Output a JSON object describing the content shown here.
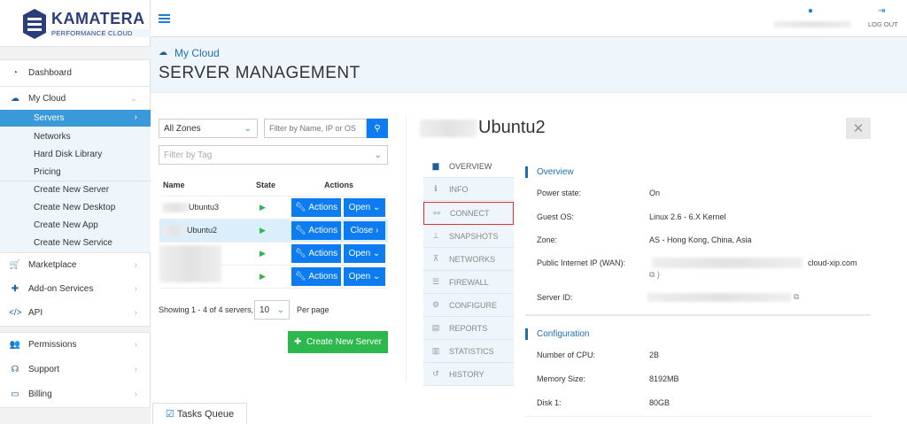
{
  "brand": {
    "name": "KAMATERA",
    "tagline": "PERFORMANCE CLOUD"
  },
  "topbar": {
    "logout": "LOG OUT"
  },
  "sidebar": {
    "items": [
      {
        "label": "Dashboard",
        "icon": "dashboard-icon"
      },
      {
        "label": "My Cloud",
        "icon": "cloud-icon"
      },
      {
        "label": "Marketplace",
        "icon": "cart-icon"
      },
      {
        "label": "Add-on Services",
        "icon": "puzzle-icon"
      },
      {
        "label": "API",
        "icon": "code-icon"
      },
      {
        "label": "Permissions",
        "icon": "users-icon"
      },
      {
        "label": "Support",
        "icon": "headset-icon"
      },
      {
        "label": "Billing",
        "icon": "credit-card-icon"
      }
    ],
    "mycloud_sub": [
      "Servers",
      "Networks",
      "Hard Disk Library",
      "Pricing"
    ],
    "create_sub": [
      "Create New Server",
      "Create New Desktop",
      "Create New App",
      "Create New Service"
    ]
  },
  "page": {
    "breadcrumb": "My Cloud",
    "title": "SERVER MANAGEMENT"
  },
  "filters": {
    "zone": "All Zones",
    "search_placeholder": "Filter by Name, IP or OS",
    "tag_placeholder": "Filter by Tag"
  },
  "table": {
    "headers": [
      "Name",
      "State",
      "Actions"
    ],
    "rows": [
      {
        "name": "Ubuntu3",
        "actions": "Actions",
        "toggle": "Open"
      },
      {
        "name": "Ubuntu2",
        "actions": "Actions",
        "toggle": "Close",
        "selected": true
      },
      {
        "name": "",
        "actions": "Actions",
        "toggle": "Open"
      },
      {
        "name": "",
        "actions": "Actions",
        "toggle": "Open"
      }
    ]
  },
  "pagination": {
    "showing": "Showing 1 - 4 of 4 servers,",
    "per_page": "10",
    "per_page_label": "Per page"
  },
  "create_button": "Create New Server",
  "tasks_queue": "Tasks Queue",
  "detail": {
    "server_name": "Ubuntu2",
    "tabs": [
      "OVERVIEW",
      "INFO",
      "CONNECT",
      "SNAPSHOTS",
      "NETWORKS",
      "FIREWALL",
      "CONFIGURE",
      "REPORTS",
      "STATISTICS",
      "HISTORY"
    ],
    "active_tab": "OVERVIEW",
    "highlighted_tab": "CONNECT",
    "overview": {
      "title": "Overview",
      "fields": [
        {
          "label": "Power state:",
          "value": "On"
        },
        {
          "label": "Guest OS:",
          "value": "Linux 2.6 - 6.X Kernel"
        },
        {
          "label": "Zone:",
          "value": "AS - Hong Kong, China, Asia"
        },
        {
          "label": "Public Internet IP (WAN):",
          "value": "cloud-xip.com"
        },
        {
          "label": "Server ID:",
          "value": ""
        }
      ]
    },
    "configuration": {
      "title": "Configuration",
      "fields": [
        {
          "label": "Number of CPU:",
          "value": "2B"
        },
        {
          "label": "Memory Size:",
          "value": "8192MB"
        },
        {
          "label": "Disk 1:",
          "value": "80GB"
        }
      ]
    }
  },
  "colors": {
    "accent": "#0c7cf0",
    "sidebar_active": "#3a9ad9",
    "success": "#2db84d",
    "highlight": "#e03030"
  }
}
